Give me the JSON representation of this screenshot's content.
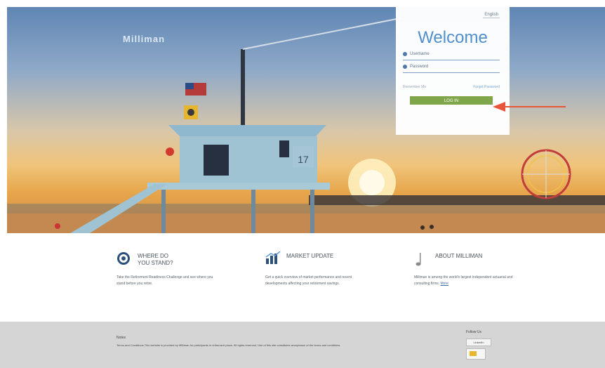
{
  "header": {
    "brand": "Milliman"
  },
  "login": {
    "language": "English",
    "welcome": "Welcome",
    "username_placeholder": "Username",
    "password_placeholder": "Password",
    "remember": "Remember Me",
    "forgot": "Forgot Password",
    "button": "LOG IN"
  },
  "hero": {
    "tower_number": "17"
  },
  "columns": [
    {
      "title": "WHERE DO\nYOU STAND?",
      "body": "Take the Retirement Readiness Challenge and see where you stand before you retire.",
      "icon": "target-icon"
    },
    {
      "title": "MARKET UPDATE",
      "body": "Get a quick overview of market performance and recent developments affecting your retirement savings.",
      "icon": "chart-icon"
    },
    {
      "title": "ABOUT MILLIMAN",
      "body": "Milliman is among the world's largest independent actuarial and consulting firms.",
      "link": "More",
      "icon": "music-note-icon"
    }
  ],
  "footer": {
    "title": "Notes",
    "text": "Terms and Conditions  This website is provided by Milliman for participants in retirement plans. All rights reserved. Use of this site constitutes acceptance of the terms and conditions.",
    "follow": "Follow Us",
    "social": "LinkedIn"
  },
  "colors": {
    "accent_blue": "#4f8fcf",
    "login_button": "#7fa64a",
    "arrow": "#e8553b",
    "footer_bg": "#d5d5d5"
  }
}
